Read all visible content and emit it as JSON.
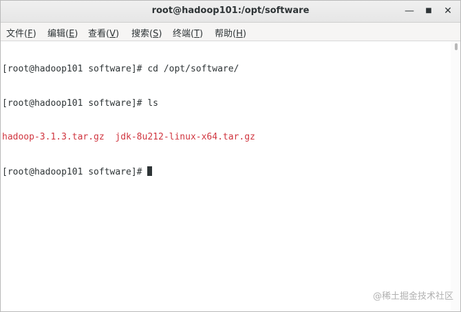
{
  "window": {
    "title": "root@hadoop101:/opt/software",
    "minimize_icon": "minimize-icon",
    "maximize_icon": "maximize-icon",
    "close_icon": "close-icon"
  },
  "menu": [
    {
      "label": "文件(",
      "key": "F",
      "end": ")"
    },
    {
      "label": "编辑(",
      "key": "E",
      "end": ")"
    },
    {
      "label": "查看(",
      "key": "V",
      "end": ")"
    },
    {
      "label": "搜索(",
      "key": "S",
      "end": ")"
    },
    {
      "label": "终端(",
      "key": "T",
      "end": ")"
    },
    {
      "label": "帮助(",
      "key": "H",
      "end": ")"
    }
  ],
  "terminal": {
    "lines": [
      {
        "prompt": "[root@hadoop101 software]# ",
        "command": "cd /opt/software/"
      },
      {
        "prompt": "[root@hadoop101 software]# ",
        "command": "ls"
      },
      {
        "output_files": [
          "hadoop-3.1.3.tar.gz",
          "jdk-8u212-linux-x64.tar.gz"
        ]
      },
      {
        "prompt": "[root@hadoop101 software]# ",
        "command": ""
      }
    ],
    "colors": {
      "text": "#2e3436",
      "archive": "#d0353f",
      "background": "#ffffff"
    }
  },
  "watermark": "@稀土掘金技术社区"
}
